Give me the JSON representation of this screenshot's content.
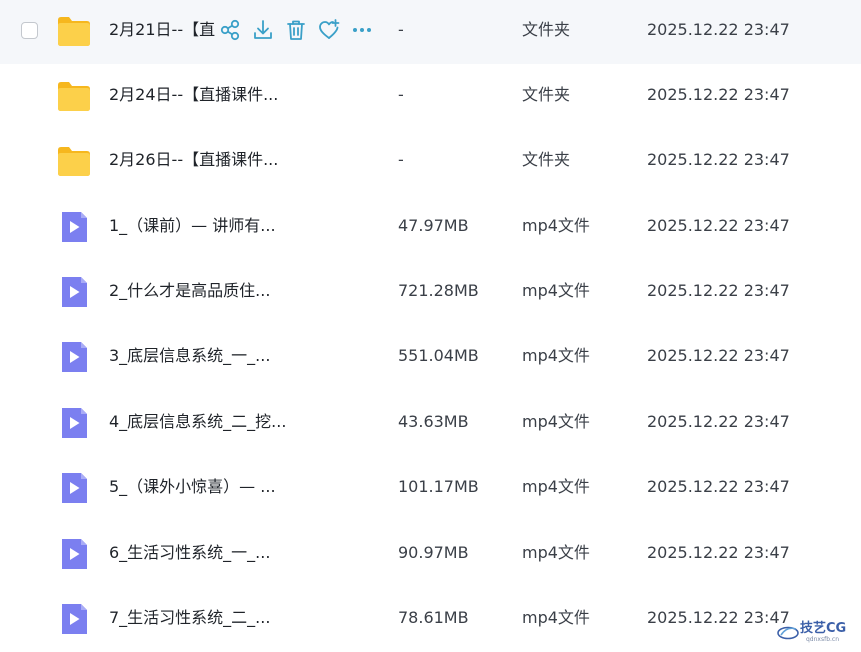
{
  "rows": [
    {
      "name": "2月21日--【直",
      "size": "-",
      "type": "文件夹",
      "date": "2025.12.22 23:47",
      "kind": "folder-icon"
    },
    {
      "name": "2月24日--【直播课件...",
      "size": "-",
      "type": "文件夹",
      "date": "2025.12.22 23:47",
      "kind": "folder-icon"
    },
    {
      "name": "2月26日--【直播课件...",
      "size": "-",
      "type": "文件夹",
      "date": "2025.12.22 23:47",
      "kind": "folder-icon"
    },
    {
      "name": "1_（课前）— 讲师有...",
      "size": "47.97MB",
      "type": "mp4文件",
      "date": "2025.12.22 23:47",
      "kind": "video-file-icon"
    },
    {
      "name": "2_什么才是高品质住...",
      "size": "721.28MB",
      "type": "mp4文件",
      "date": "2025.12.22 23:47",
      "kind": "video-file-icon"
    },
    {
      "name": "3_底层信息系统_一_...",
      "size": "551.04MB",
      "type": "mp4文件",
      "date": "2025.12.22 23:47",
      "kind": "video-file-icon"
    },
    {
      "name": "4_底层信息系统_二_挖...",
      "size": "43.63MB",
      "type": "mp4文件",
      "date": "2025.12.22 23:47",
      "kind": "video-file-icon"
    },
    {
      "name": "5_（课外小惊喜）— ...",
      "size": "101.17MB",
      "type": "mp4文件",
      "date": "2025.12.22 23:47",
      "kind": "video-file-icon"
    },
    {
      "name": "6_生活习性系统_一_...",
      "size": "90.97MB",
      "type": "mp4文件",
      "date": "2025.12.22 23:47",
      "kind": "video-file-icon"
    },
    {
      "name": "7_生活习性系统_二_...",
      "size": "78.61MB",
      "type": "mp4文件",
      "date": "2025.12.22 23:47",
      "kind": "video-file-icon"
    }
  ],
  "row_actions": [
    "share-icon",
    "download-icon",
    "delete-icon",
    "favorite-icon",
    "more-icon"
  ],
  "colors": {
    "accent": "#3aa0c8",
    "folder": "#fbc93f",
    "video": "#7b7ff0",
    "hover_row": "#f5f7fa"
  },
  "watermark": {
    "text": "技艺CG",
    "sub": "qdnxsfb.cn"
  }
}
